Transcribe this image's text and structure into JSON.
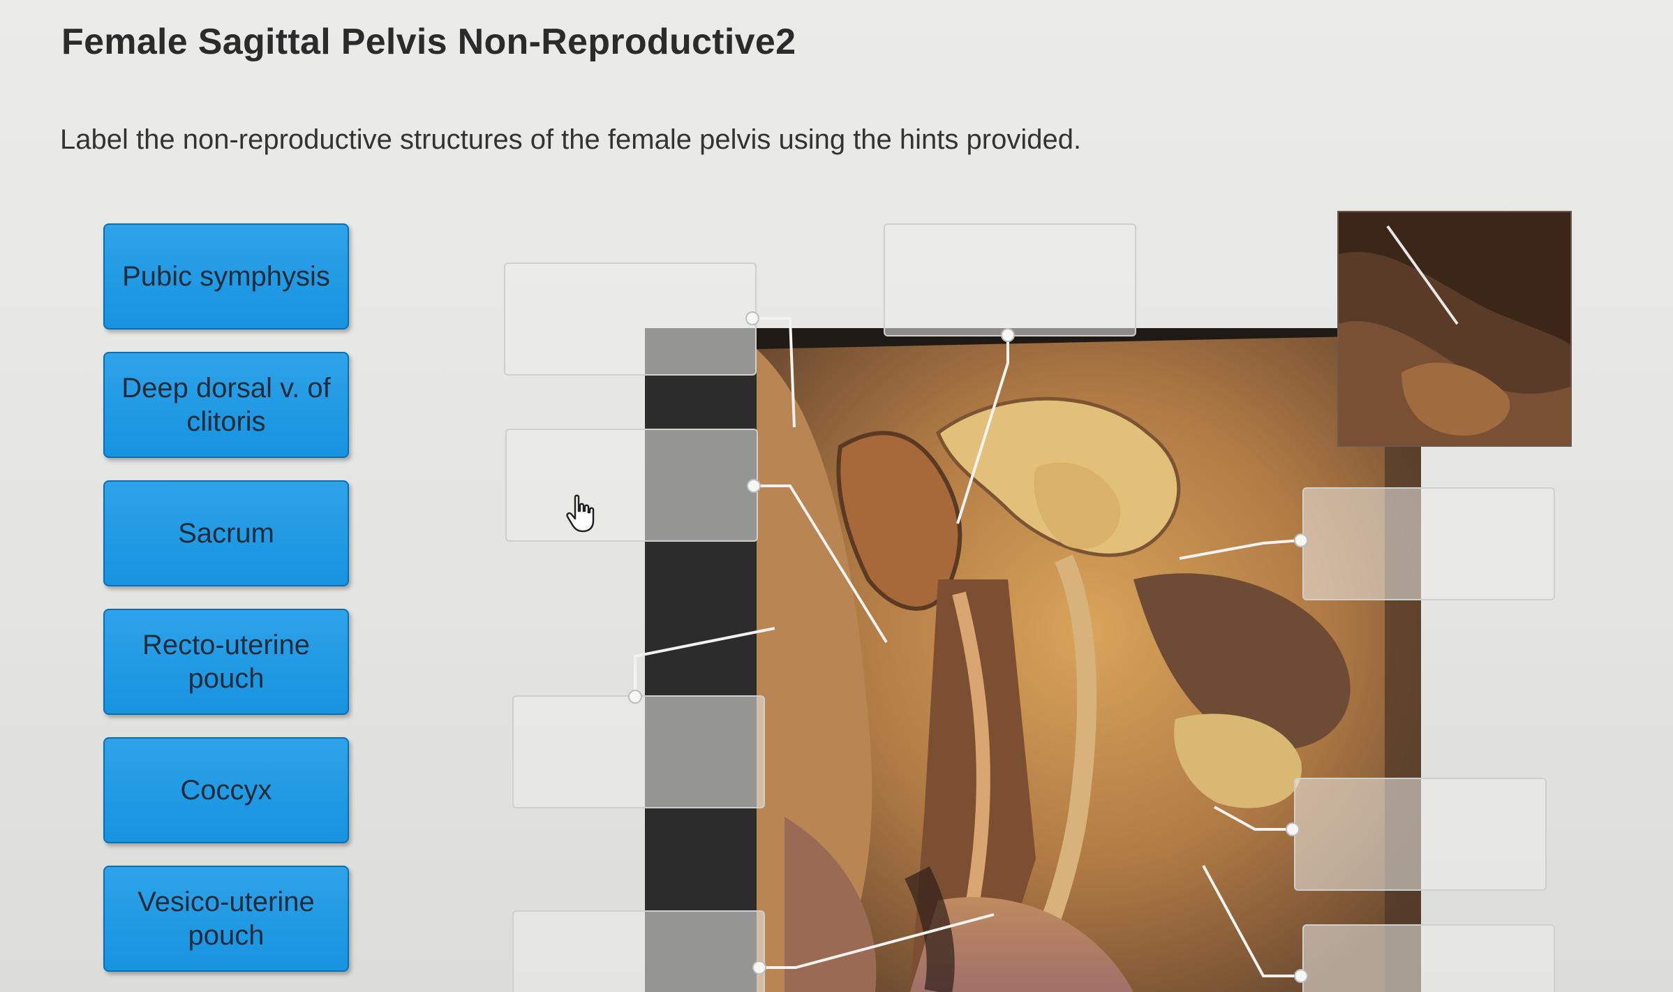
{
  "page": {
    "title": "Female Sagittal Pelvis Non-Reproductive2",
    "instructions": "Label the non-reproductive structures of the female pelvis using the hints provided."
  },
  "labels": [
    {
      "text": "Pubic symphysis"
    },
    {
      "text": "Deep dorsal v. of clitoris"
    },
    {
      "text": "Sacrum"
    },
    {
      "text": "Recto-uterine pouch"
    },
    {
      "text": "Coccyx"
    },
    {
      "text": "Vesico-uterine pouch"
    }
  ],
  "drop_zones": [
    {
      "value": ""
    },
    {
      "value": ""
    },
    {
      "value": ""
    },
    {
      "value": ""
    },
    {
      "value": ""
    },
    {
      "value": ""
    },
    {
      "value": ""
    },
    {
      "value": ""
    }
  ],
  "figure": {
    "image_name": "sagittal-pelvis-dissection-photo",
    "inset_name": "pelvis-detail-inset-photo"
  },
  "cursor": {
    "icon": "hand-pointer-icon"
  },
  "colors": {
    "label_fill": "#1e98e4",
    "label_border": "#0d6fb0",
    "leader_line": "#f2f2f0"
  }
}
